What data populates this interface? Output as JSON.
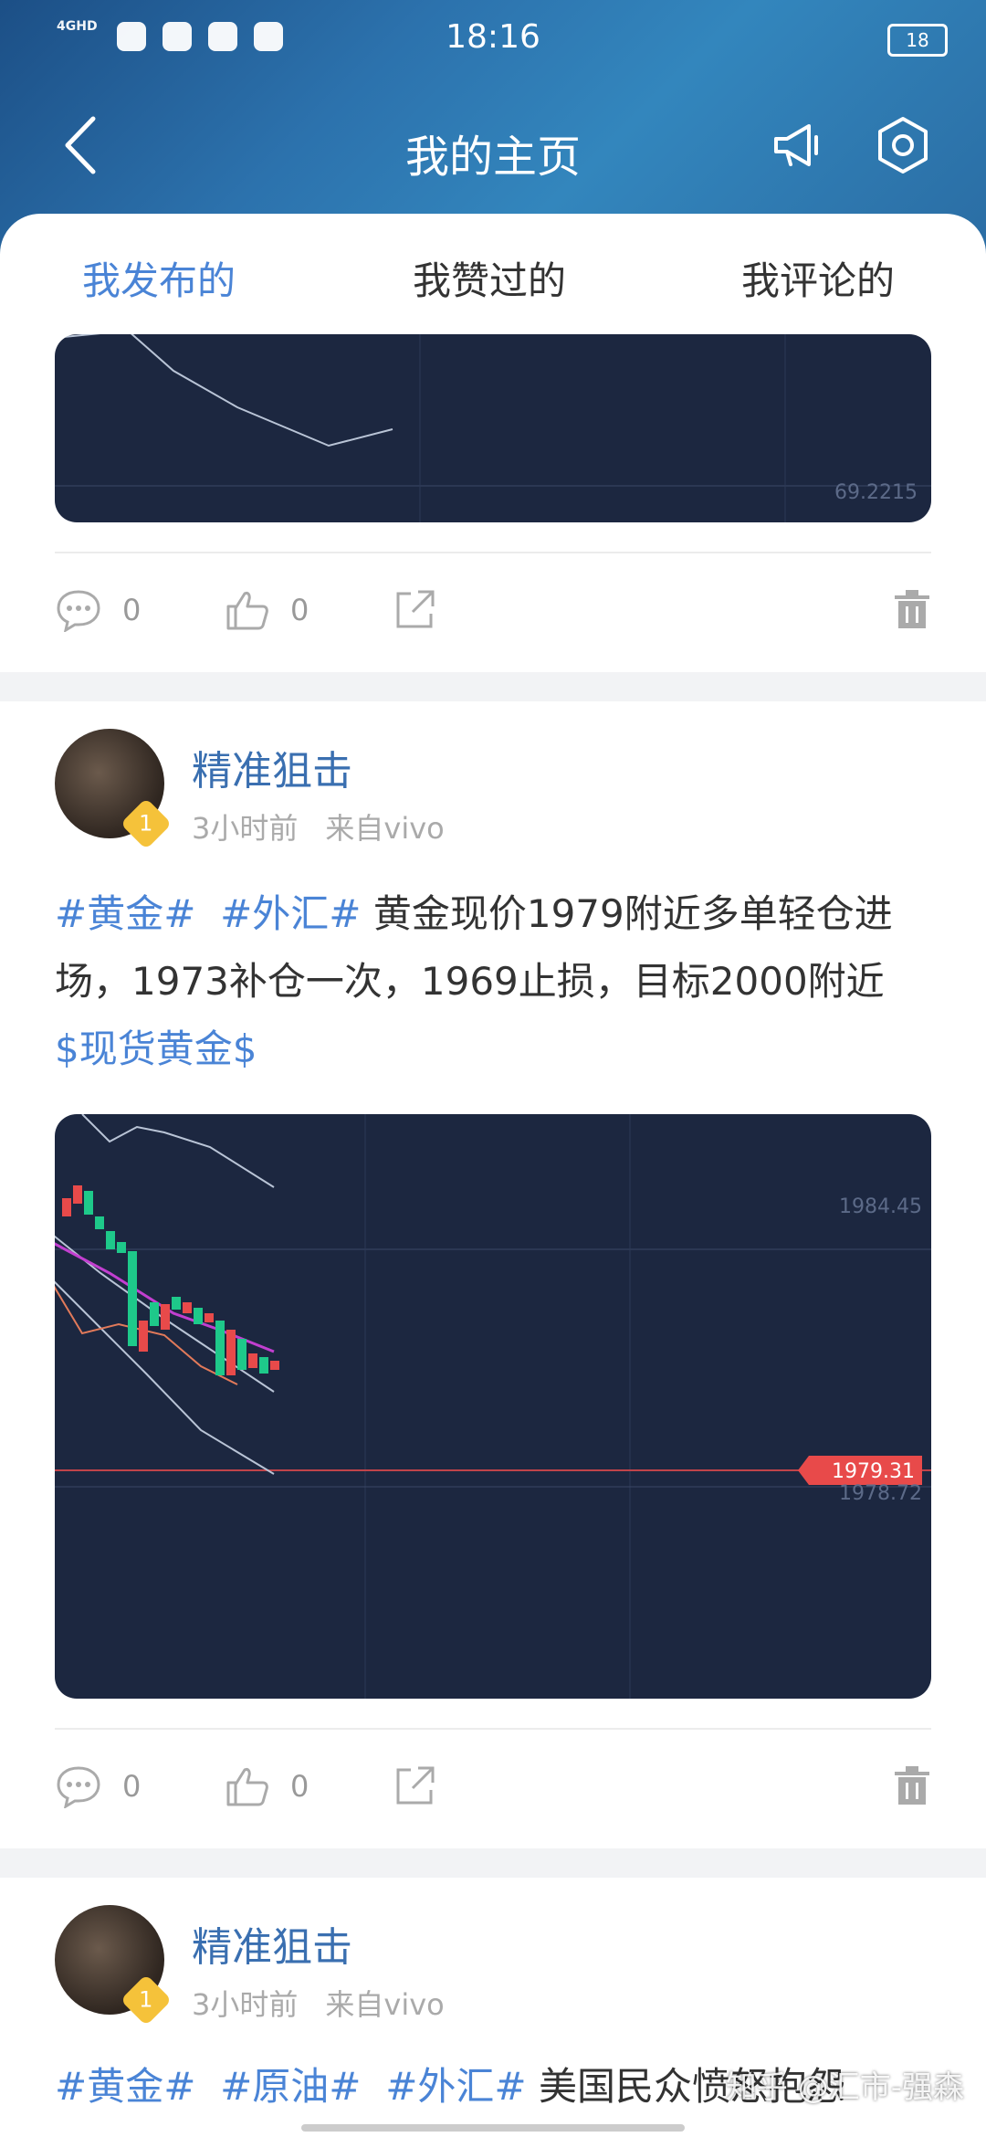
{
  "status_bar": {
    "network": "4GHD",
    "time": "18:16",
    "battery": "18"
  },
  "header": {
    "title": "我的主页"
  },
  "tabs": [
    {
      "label": "我发布的",
      "active": true
    },
    {
      "label": "我赞过的",
      "active": false
    },
    {
      "label": "我评论的",
      "active": false
    }
  ],
  "post0": {
    "chart_price_label": "69.2215",
    "comments": "0",
    "likes": "0"
  },
  "post1": {
    "author": "精准狙击",
    "level": "1",
    "time": "3小时前",
    "source": "来自vivo",
    "tags": [
      "#黄金#",
      "#外汇#"
    ],
    "text": "黄金现价1979附近多单轻仓进场，1973补仓一次，1969止损，目标2000附近",
    "stock_tag": "$现货黄金$",
    "chart": {
      "price_high": "1984.45",
      "current": "1979.31",
      "price_low": "1978.72"
    },
    "comments": "0",
    "likes": "0"
  },
  "post2": {
    "author": "精准狙击",
    "level": "1",
    "time": "3小时前",
    "source": "来自vivo",
    "tags": [
      "#黄金#",
      "#原油#",
      "#外汇#"
    ],
    "text": "美国民众愤怒抱怨"
  },
  "watermark": "知乎 @汇市-强森",
  "colors": {
    "accent": "#4a84d6",
    "username": "#3a6fb0",
    "chart_bg": "#1c2740",
    "price_tag": "#e84a4a"
  }
}
